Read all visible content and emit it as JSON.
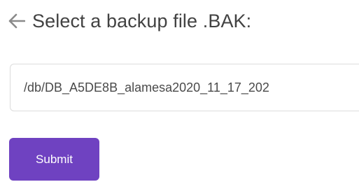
{
  "header": {
    "back_icon": "arrow-left-icon",
    "title": "Select a backup file  .BAK:"
  },
  "form": {
    "path_value": "/db/DB_A5DE8B_alamesa2020_11_17_202",
    "submit_label": "Submit"
  },
  "colors": {
    "text": "#424242",
    "icon": "#888888",
    "input_border": "#dcdcdc",
    "button_bg": "#6f42c1",
    "button_text": "#ffffff"
  }
}
